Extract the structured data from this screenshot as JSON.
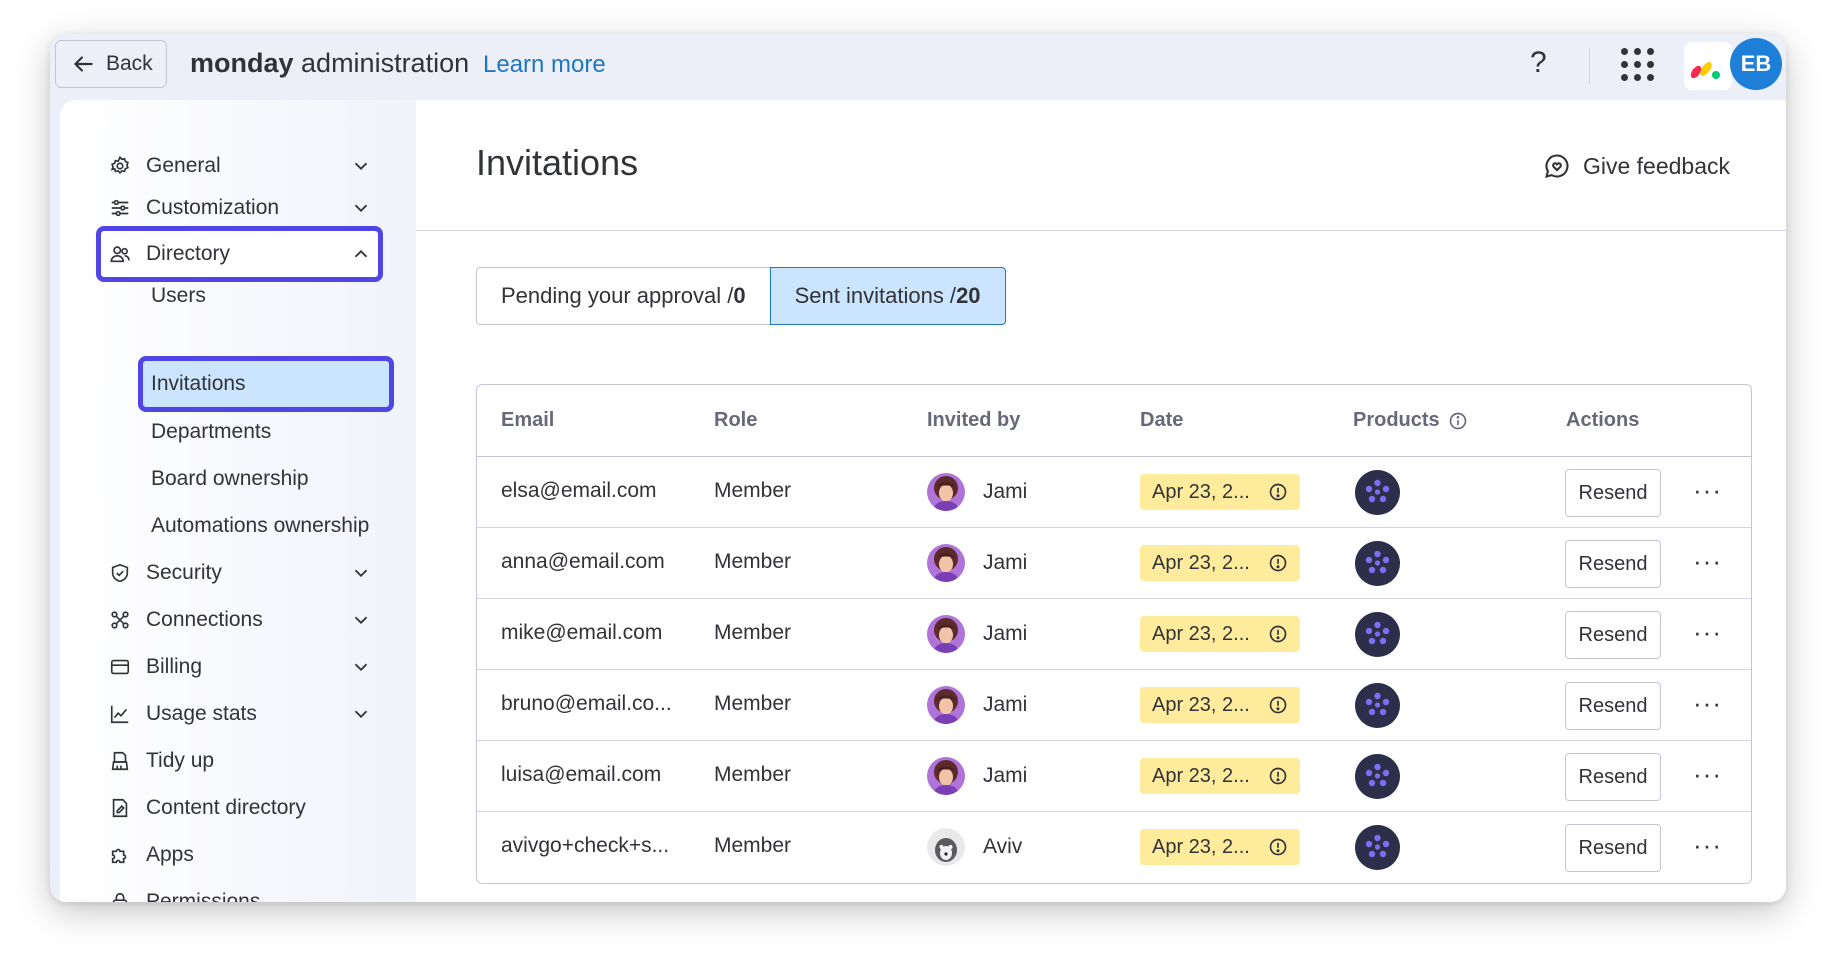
{
  "header": {
    "back_label": "Back",
    "app_title_bold": "monday",
    "app_title_rest": " administration",
    "learn_more": "Learn more",
    "help_glyph": "?",
    "user_initials": "EB",
    "user_avatar_color": "#1d7fd8"
  },
  "sidebar": {
    "items": [
      {
        "label": "General",
        "icon": "gear-icon"
      },
      {
        "label": "Customization",
        "icon": "sliders-icon"
      },
      {
        "label": "Directory",
        "icon": "people-icon"
      },
      {
        "label": "Security",
        "icon": "shield-icon"
      },
      {
        "label": "Connections",
        "icon": "connections-icon"
      },
      {
        "label": "Billing",
        "icon": "credit-card-icon"
      },
      {
        "label": "Usage stats",
        "icon": "chart-icon"
      },
      {
        "label": "Tidy up",
        "icon": "broom-icon"
      },
      {
        "label": "Content directory",
        "icon": "document-icon"
      },
      {
        "label": "Apps",
        "icon": "puzzle-icon"
      },
      {
        "label": "Permissions",
        "icon": "lock-icon"
      }
    ],
    "directory_sub": [
      "Users",
      "Invitations",
      "Departments",
      "Board ownership",
      "Automations ownership"
    ],
    "highlight_color": "#5046e5"
  },
  "main": {
    "title": "Invitations",
    "feedback_label": "Give feedback",
    "tabs": [
      {
        "label": "Pending your approval /",
        "count": "0"
      },
      {
        "label": "Sent invitations /",
        "count": "20"
      }
    ],
    "columns": [
      "Email",
      "Role",
      "Invited by",
      "Date",
      "Products",
      "Actions"
    ],
    "rows": [
      {
        "email": "elsa@email.com",
        "role": "Member",
        "invited_by": "Jami",
        "date": "Apr 23, 2...",
        "action": "Resend"
      },
      {
        "email": "anna@email.com",
        "role": "Member",
        "invited_by": "Jami",
        "date": "Apr 23, 2...",
        "action": "Resend"
      },
      {
        "email": "mike@email.com",
        "role": "Member",
        "invited_by": "Jami",
        "date": "Apr 23, 2...",
        "action": "Resend"
      },
      {
        "email": "bruno@email.co...",
        "role": "Member",
        "invited_by": "Jami",
        "date": "Apr 23, 2...",
        "action": "Resend"
      },
      {
        "email": "luisa@email.com",
        "role": "Member",
        "invited_by": "Jami",
        "date": "Apr 23, 2...",
        "action": "Resend"
      },
      {
        "email": "avivgo+check+s...",
        "role": "Member",
        "invited_by": "Aviv",
        "date": "Apr 23, 2...",
        "action": "Resend"
      }
    ],
    "more_glyph": "···",
    "accent_color": "#1f76c2",
    "date_chip_color": "#ffeb9c"
  }
}
